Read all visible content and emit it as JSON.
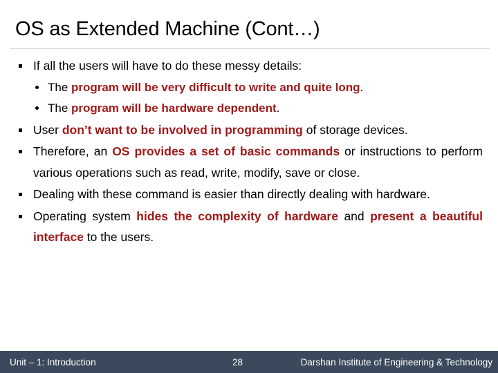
{
  "slide": {
    "title": "OS as Extended Machine (Cont…)",
    "accent_color": "#A01A1A",
    "text_color": "#000000",
    "background_color": "#FFFFFF",
    "rule_color": "#D9D9D9"
  },
  "bullets": [
    {
      "level": 1,
      "runs": [
        {
          "text": "If all the users will have to do these messy details:",
          "emphasis": false
        }
      ],
      "children": [
        {
          "level": 2,
          "runs": [
            {
              "text": "The ",
              "emphasis": false
            },
            {
              "text": "program will be very difficult to write and quite long",
              "emphasis": true
            },
            {
              "text": ".",
              "emphasis": false
            }
          ]
        },
        {
          "level": 2,
          "runs": [
            {
              "text": "The ",
              "emphasis": false
            },
            {
              "text": "program will be hardware dependent",
              "emphasis": true
            },
            {
              "text": ".",
              "emphasis": false
            }
          ]
        }
      ]
    },
    {
      "level": 1,
      "runs": [
        {
          "text": "User ",
          "emphasis": false
        },
        {
          "text": "don’t want to be involved in programming",
          "emphasis": true
        },
        {
          "text": " of storage devices.",
          "emphasis": false
        }
      ],
      "children": []
    },
    {
      "level": 1,
      "runs": [
        {
          "text": "Therefore, an ",
          "emphasis": false
        },
        {
          "text": "OS provides a set of basic commands",
          "emphasis": true
        },
        {
          "text": " or instructions to perform various operations such as read, write, modify, save or close.",
          "emphasis": false
        }
      ],
      "children": []
    },
    {
      "level": 1,
      "runs": [
        {
          "text": "Dealing with these command is easier than directly dealing with hardware.",
          "emphasis": false
        }
      ],
      "children": []
    },
    {
      "level": 1,
      "runs": [
        {
          "text": "Operating system ",
          "emphasis": false
        },
        {
          "text": "hides the complexity of hardware",
          "emphasis": true
        },
        {
          "text": " and ",
          "emphasis": false
        },
        {
          "text": "present a beautiful interface",
          "emphasis": true
        },
        {
          "text": " to the users.",
          "emphasis": false
        }
      ],
      "children": []
    }
  ],
  "footer": {
    "background_color": "#3A4A5C",
    "text_color": "#FFFFFF",
    "left_label": "Unit – 1: Introduction",
    "page_number": "28",
    "right_label": "Darshan Institute of Engineering & Technology"
  }
}
